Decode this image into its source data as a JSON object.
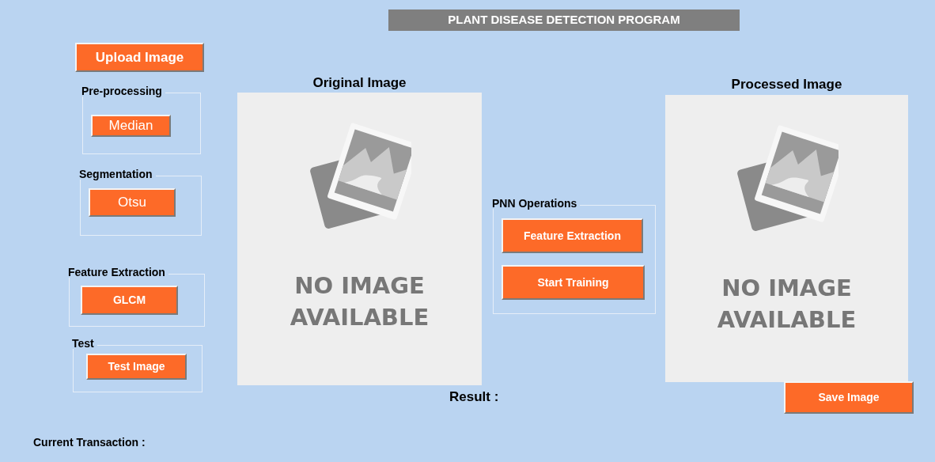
{
  "title": "PLANT DISEASE DETECTION PROGRAM",
  "upload_button": "Upload Image",
  "left_panels": [
    {
      "title": "Pre-processing",
      "button": "Median"
    },
    {
      "title": "Segmentation",
      "button": "Otsu"
    },
    {
      "title": "Feature Extraction",
      "button": "GLCM"
    },
    {
      "title": "Test",
      "button": "Test Image"
    }
  ],
  "image_views": [
    {
      "title": "Original Image",
      "placeholder": "NO IMAGE AVAILABLE"
    },
    {
      "title": "Processed Image",
      "placeholder": "NO IMAGE AVAILABLE"
    }
  ],
  "pnn_panel": {
    "title": "PNN Operations",
    "buttons": [
      "Feature Extraction",
      "Start Training"
    ]
  },
  "result_label": "Result :",
  "save_button": "Save Image",
  "status_label": "Current Transaction :"
}
